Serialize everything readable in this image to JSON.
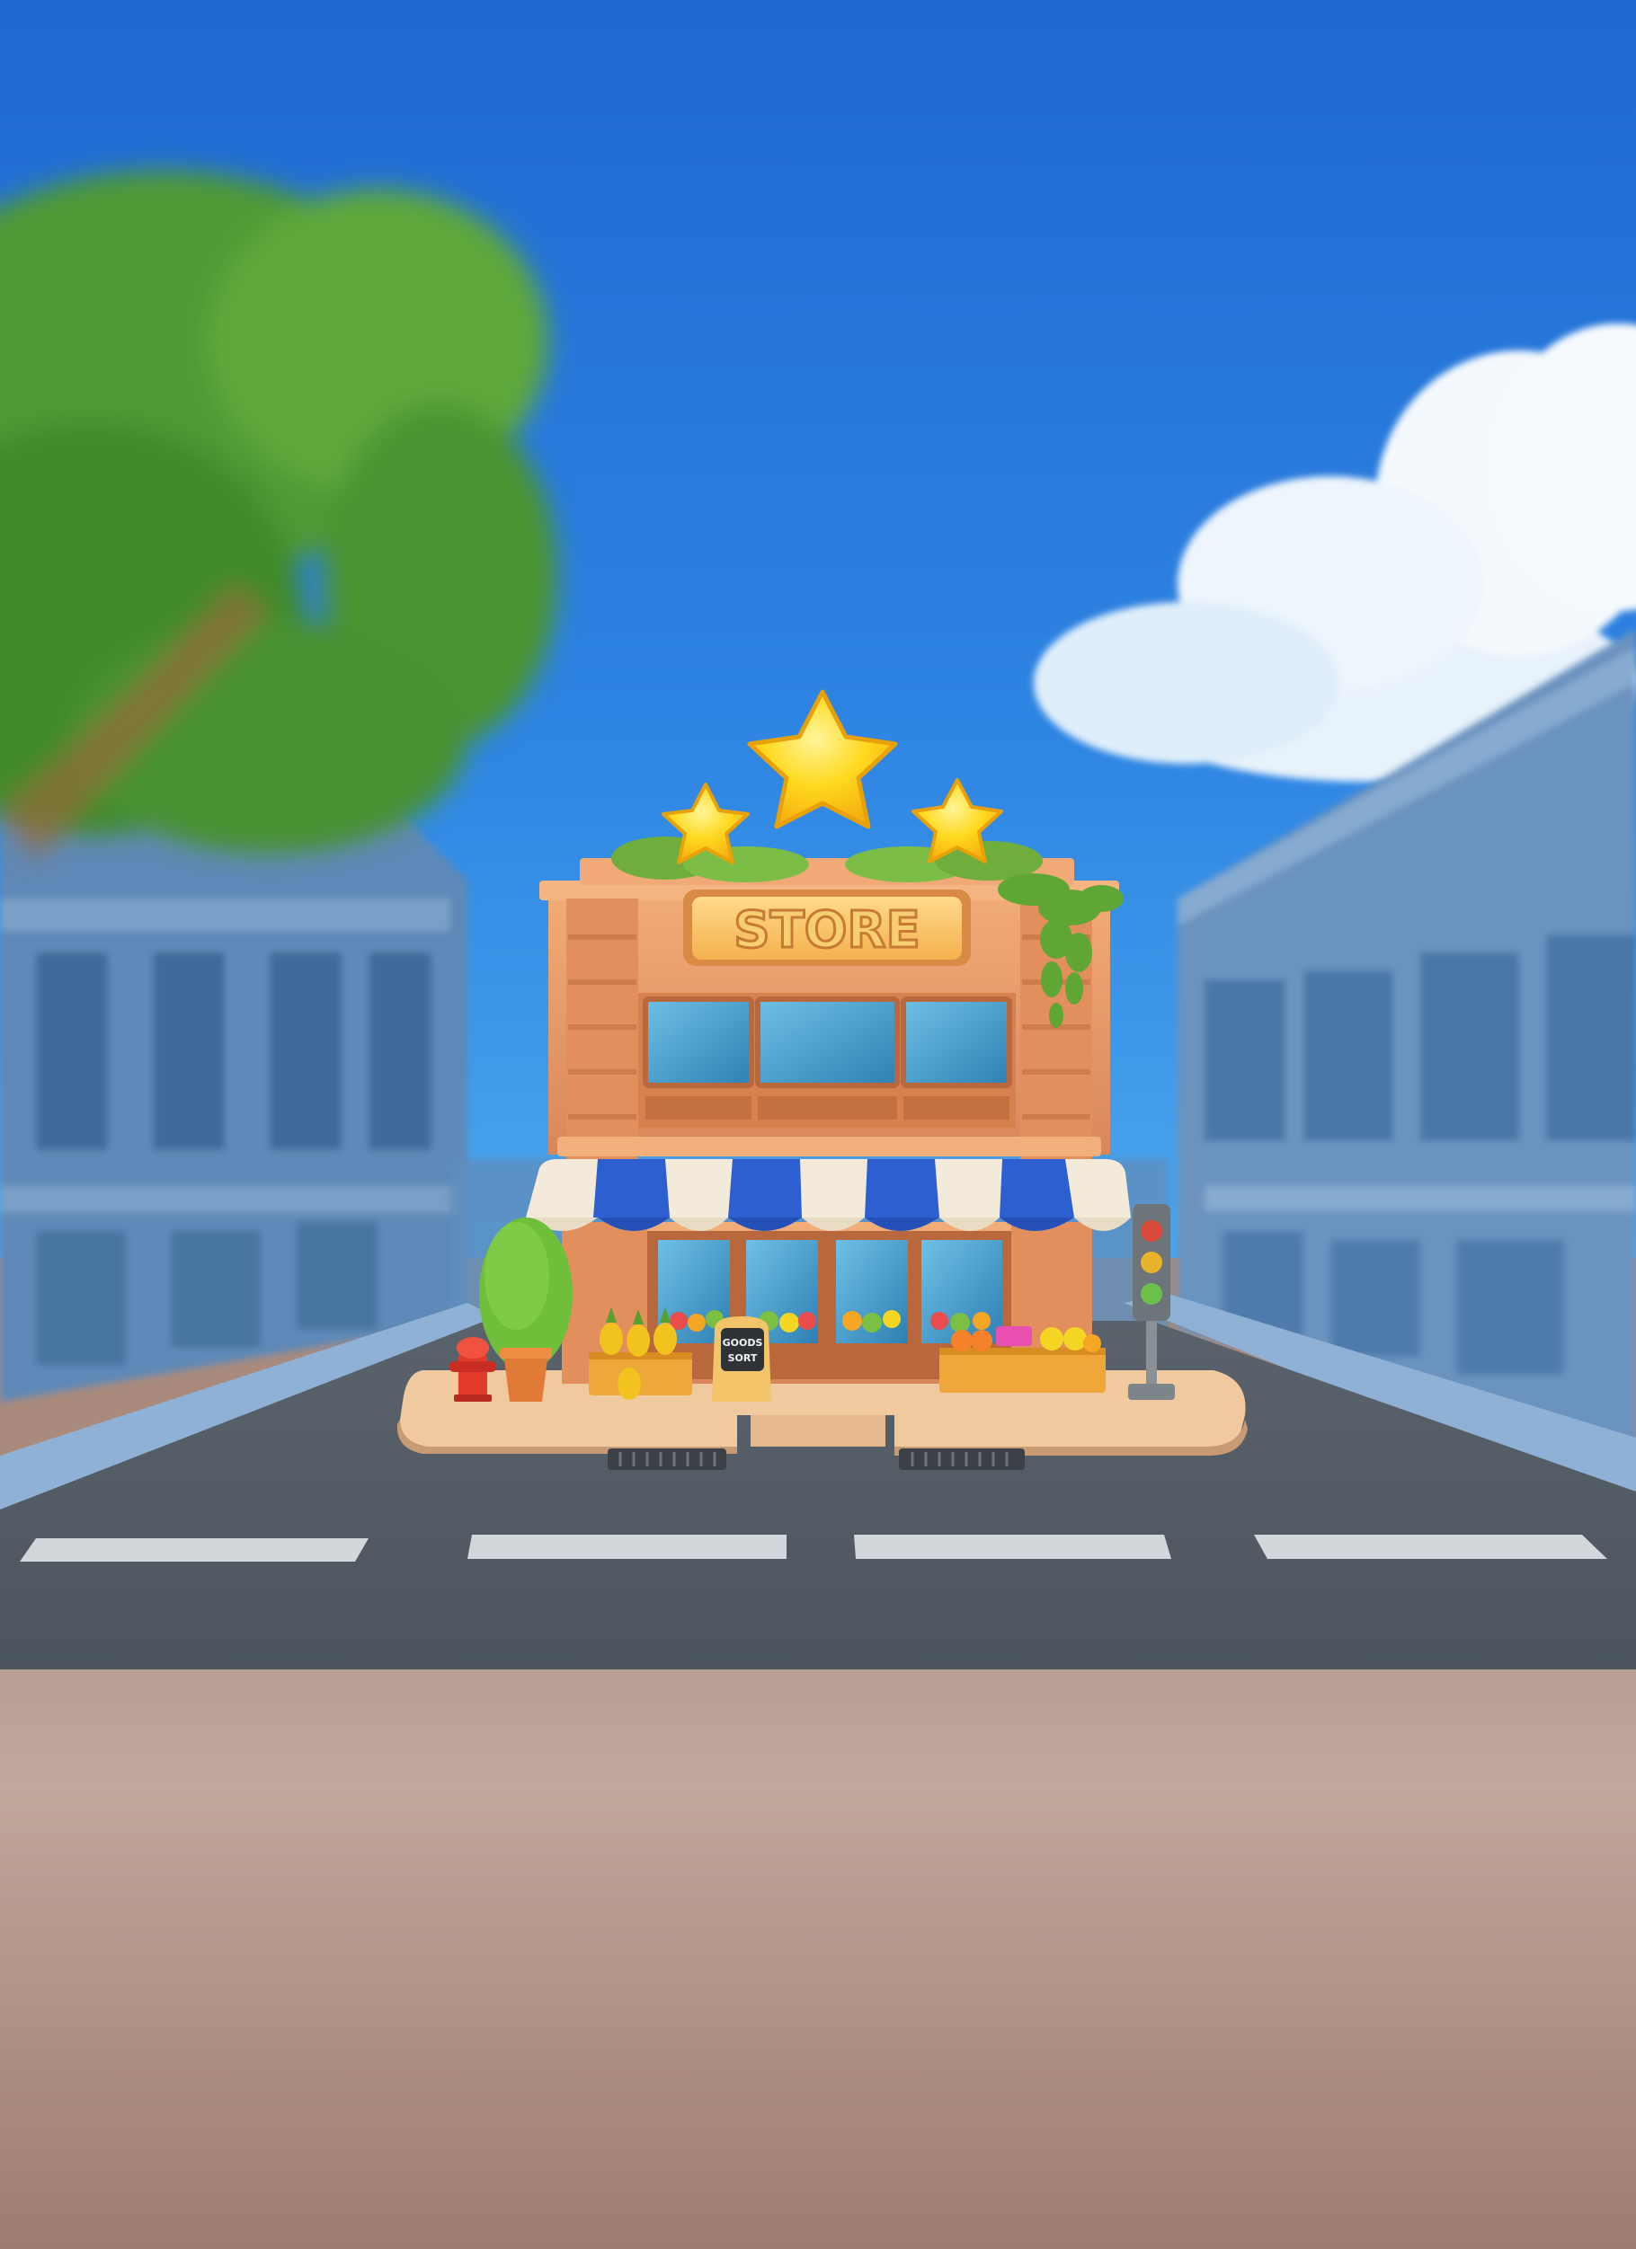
{
  "scene": {
    "title": "Goods Sort store scene",
    "store_sign": "STORE",
    "chalkboard_line1": "GOODS",
    "chalkboard_line2": "SORT",
    "stars_shown": 3
  },
  "colors": {
    "sky_top": "#1f6fd6",
    "sky_bottom": "#3f9aea",
    "road": "#535d66",
    "ground": "#a7877a",
    "brick": "#e89a66",
    "awning_blue": "#2d5fd0",
    "star": "#ffd21e"
  }
}
